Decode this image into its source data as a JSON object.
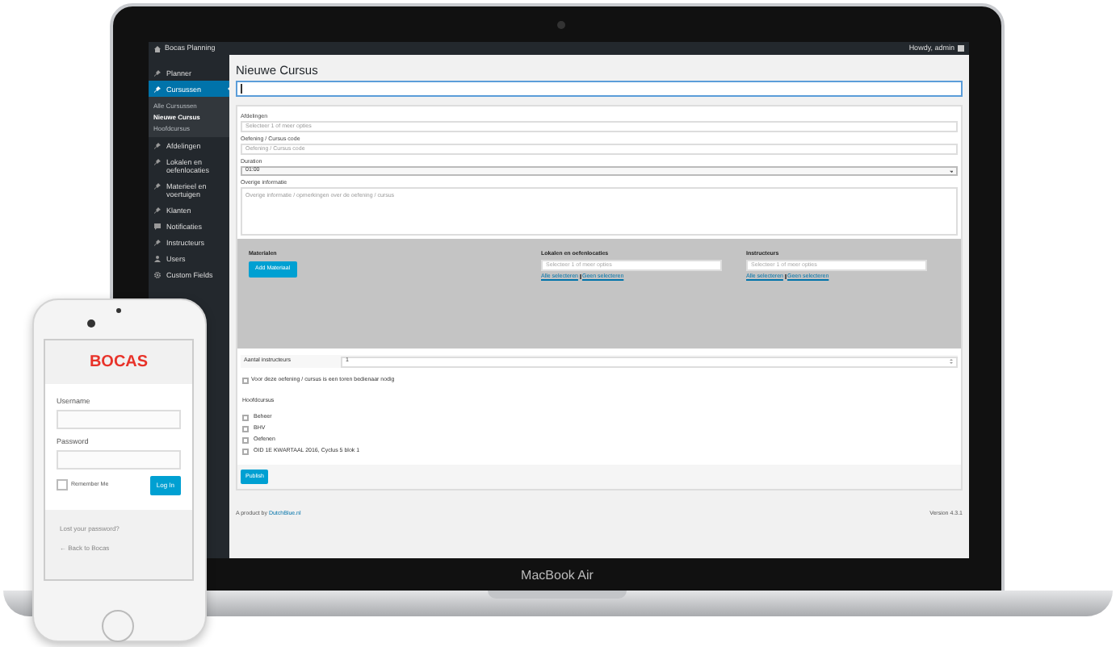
{
  "laptop": {
    "label": "MacBook Air"
  },
  "admin_bar": {
    "site": "Bocas Planning",
    "greeting": "Howdy, admin"
  },
  "sidebar": {
    "items": [
      {
        "label": "Planner",
        "kind": "pin",
        "selected": false
      },
      {
        "label": "Cursussen",
        "kind": "pin",
        "selected": true,
        "children": [
          {
            "label": "Alle Cursussen",
            "selected": false
          },
          {
            "label": "Nieuwe Cursus",
            "selected": true
          },
          {
            "label": "Hoofdcursus",
            "selected": false
          }
        ]
      },
      {
        "label": "Afdelingen",
        "kind": "pin",
        "selected": false
      },
      {
        "label": "Lokalen en oefenlocaties",
        "kind": "pin",
        "selected": false
      },
      {
        "label": "Materieel en voertuigen",
        "kind": "pin",
        "selected": false
      },
      {
        "label": "Klanten",
        "kind": "pin",
        "selected": false
      },
      {
        "label": "Notificaties",
        "kind": "comment",
        "selected": false
      },
      {
        "label": "Instructeurs",
        "kind": "pin",
        "selected": false
      },
      {
        "label": "Users",
        "kind": "users",
        "selected": false
      },
      {
        "label": "Custom Fields",
        "kind": "gear",
        "selected": false
      }
    ]
  },
  "page": {
    "title": "Nieuwe Cursus",
    "fields": [
      {
        "kind": "select",
        "label": "Afdelingen",
        "placeholder": "Selecteer 1 of meer opties"
      },
      {
        "kind": "text",
        "label": "Oefening / Cursus code",
        "placeholder": "Oefening / Cursus code"
      },
      {
        "kind": "dropdown",
        "label": "Duration",
        "value": "01:00"
      },
      {
        "kind": "textarea",
        "label": "Overige informatie",
        "placeholder": "Overige informatie / opmerkingen over de oefening / cursus"
      }
    ],
    "materials": {
      "label": "Materialen",
      "button": "Add Materiaal"
    },
    "pickers": [
      {
        "label": "Lokalen en oefenlocaties",
        "placeholder": "Selecteer 1 of meer opties",
        "links": [
          "Alle selecteren",
          "Geen selecteren"
        ]
      },
      {
        "label": "Instructeurs",
        "placeholder": "Selecteer 1 of meer opties",
        "links": [
          "Alle selecteren",
          "Geen selecteren"
        ]
      }
    ],
    "instructor_count": {
      "label": "Aantal instructeurs",
      "value": "1"
    },
    "operator_checkbox": {
      "label": "Voor deze oefening / cursus is een toren bedienaar nodig",
      "checked": false
    },
    "main_course": {
      "label": "Hoofdcursus",
      "options": [
        {
          "label": "Beheer",
          "checked": false
        },
        {
          "label": "BHV",
          "checked": false
        },
        {
          "label": "Oefenen",
          "checked": false
        },
        {
          "label": "OID 1E KWARTAAL 2016, Cyclus 5 blok 1",
          "checked": false
        }
      ]
    },
    "publish": "Publish",
    "footer": {
      "credit": "A product by",
      "credit_link": "DutchBlue.nl",
      "version": "Version 4.3.1"
    }
  },
  "phone": {
    "logo": "BOCAS",
    "username_label": "Username",
    "password_label": "Password",
    "remember": {
      "label": "Remember Me",
      "checked": false
    },
    "button": "Log In",
    "links": [
      "Lost your password?",
      "← Back to Bocas"
    ]
  }
}
